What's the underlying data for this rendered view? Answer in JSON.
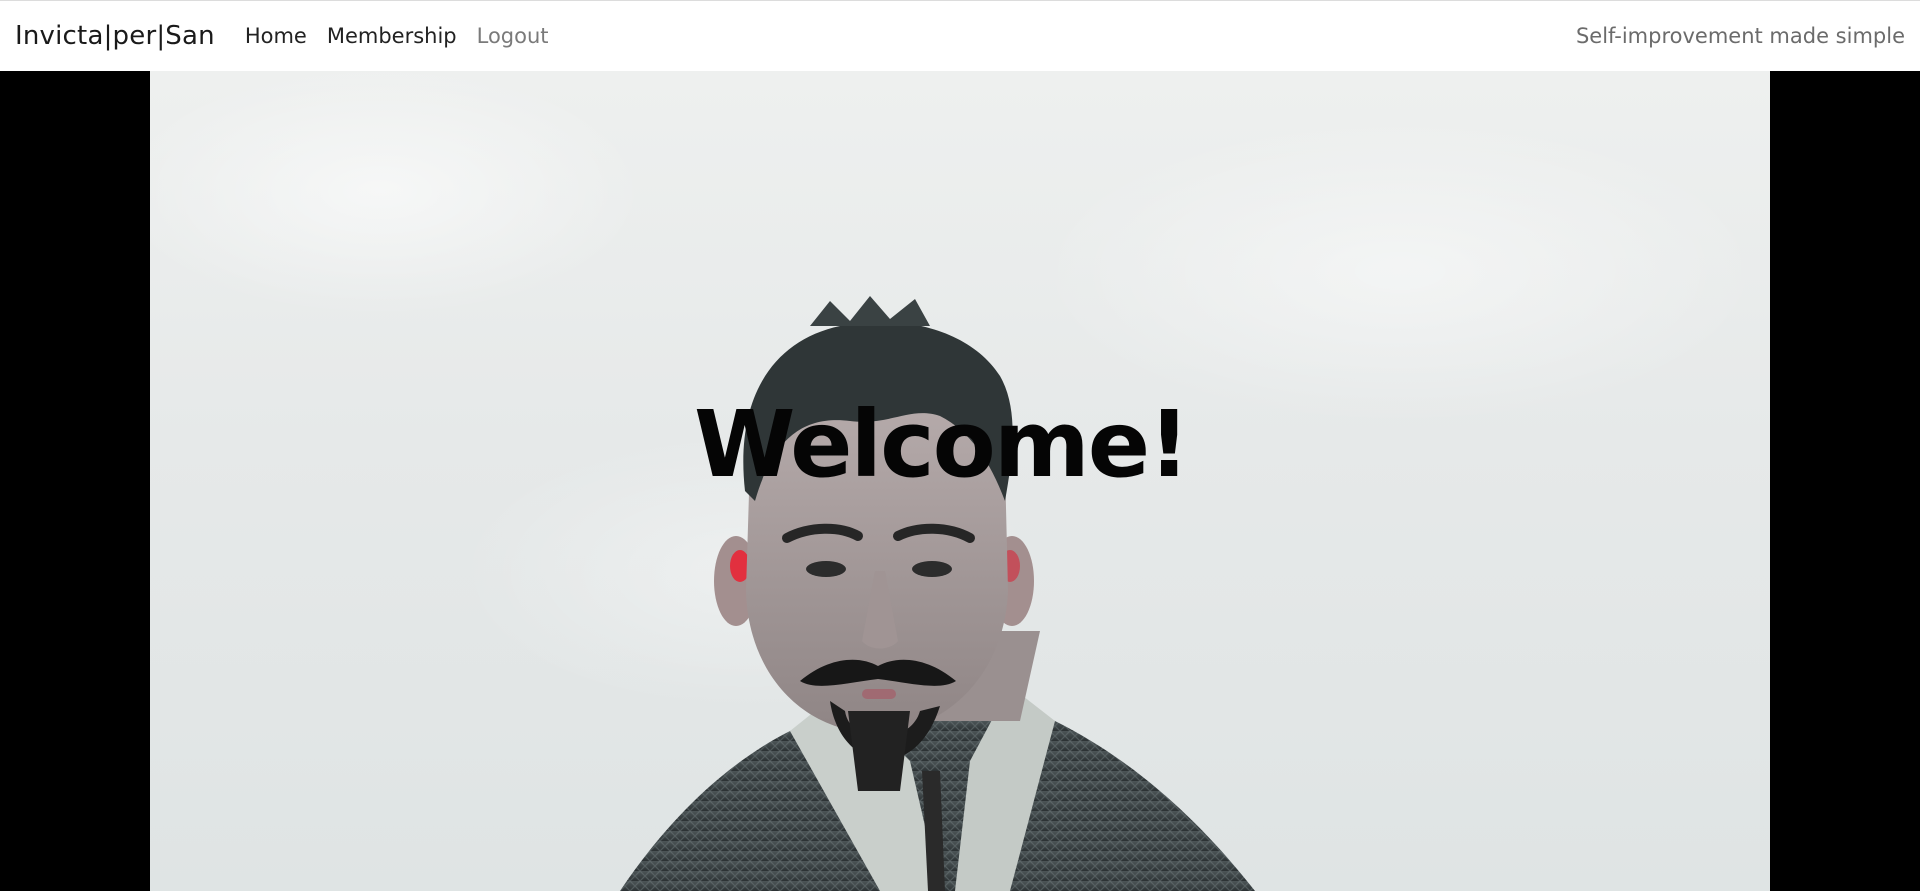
{
  "navbar": {
    "brand": "Invicta|per|San",
    "links": [
      {
        "label": "Home"
      },
      {
        "label": "Membership"
      },
      {
        "label": "Logout"
      }
    ],
    "tagline": "Self-improvement made simple"
  },
  "hero": {
    "heading": "Welcome!",
    "image_subject": "portrait-photo"
  },
  "colors": {
    "navbar_bg": "#ffffff",
    "page_bg": "#000000",
    "heading": "#050505",
    "muted_link": "#7a7a7a"
  }
}
